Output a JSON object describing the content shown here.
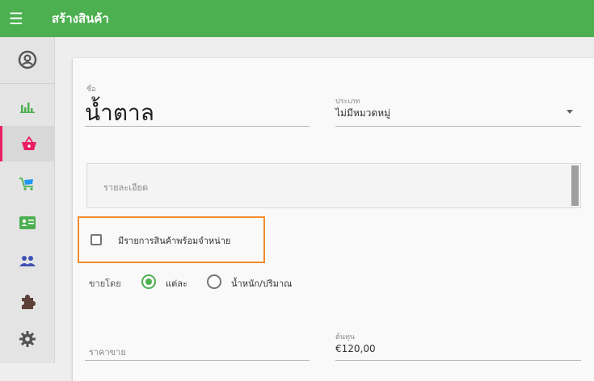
{
  "header": {
    "menu_icon": "hamburger-icon",
    "title": "สร้างสินค้า",
    "color": "#4caf50"
  },
  "sidebar": {
    "items": [
      {
        "icon": "account-circle-icon"
      },
      {
        "icon": "bar-chart-icon"
      },
      {
        "icon": "basket-icon",
        "active": true
      },
      {
        "icon": "cart-icon"
      },
      {
        "icon": "id-card-icon"
      },
      {
        "icon": "people-icon"
      },
      {
        "icon": "puzzle-icon"
      },
      {
        "icon": "gear-icon"
      }
    ]
  },
  "form": {
    "name_label": "ชื่อ",
    "name_value": "น้ำตาล",
    "category_label": "ประเภท",
    "category_value": "ไม่มีหมวดหมู่",
    "description_placeholder": "รายละเอียด",
    "available_label": "มีรายการสินค้าพร้อมจำหน่าย",
    "available_checked": false,
    "sold_by_label": "ขายโดย",
    "sold_by_options": [
      "แต่ละ",
      "น้ำหนัก/ปริมาณ"
    ],
    "sold_by_selected": "แต่ละ",
    "price_placeholder": "ราคาขาย",
    "cost_label": "ต้นทุน",
    "cost_value": "€120,00"
  },
  "colors": {
    "accent": "#4caf50",
    "active_sidebar": "#e91e63",
    "highlight": "#f28b2c"
  }
}
